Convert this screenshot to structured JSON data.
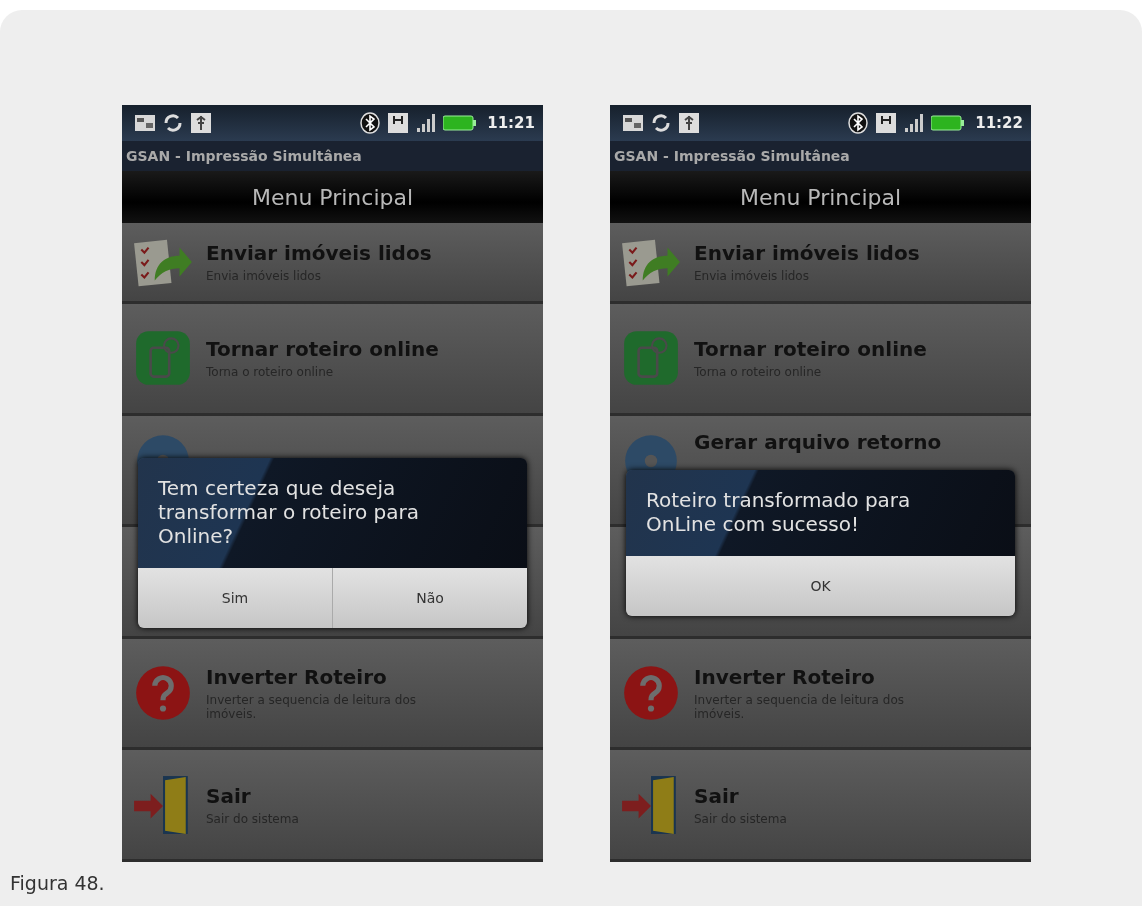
{
  "figures": [
    {
      "status_bar": {
        "time": "11:21"
      },
      "app_title": "GSAN - Impressão Simultânea",
      "header": "Menu Principal",
      "menu_items": [
        {
          "kind": "item",
          "title": "Enviar imóveis lidos",
          "subtitle": "Envia imóveis lidos"
        },
        {
          "kind": "item",
          "title": "Tornar roteiro online",
          "subtitle": "Torna o roteiro online"
        },
        {
          "kind": "covered"
        },
        {
          "kind": "covered"
        },
        {
          "kind": "item",
          "title": "Inverter Roteiro",
          "subtitle": "Inverter a sequencia de leitura dos imóveis."
        },
        {
          "kind": "item",
          "title": "Sair",
          "subtitle": "Sair do sistema"
        }
      ],
      "dialog": {
        "message": "Tem certeza que deseja transformar o roteiro para Online?",
        "buttons": [
          "Sim",
          "Não"
        ]
      }
    },
    {
      "status_bar": {
        "time": "11:22"
      },
      "app_title": "GSAN - Impressão Simultânea",
      "header": "Menu Principal",
      "menu_items": [
        {
          "kind": "item",
          "title": "Enviar imóveis lidos",
          "subtitle": "Envia imóveis lidos"
        },
        {
          "kind": "item",
          "title": "Tornar roteiro online",
          "subtitle": "Torna o roteiro online"
        },
        {
          "kind": "item",
          "title": "Gerar arquivo retorno"
        },
        {
          "kind": "covered"
        },
        {
          "kind": "item",
          "title": "Inverter Roteiro",
          "subtitle": "Inverter a sequencia de leitura dos imóveis."
        },
        {
          "kind": "item",
          "title": "Sair",
          "subtitle": "Sair do sistema"
        }
      ],
      "dialog": {
        "message": "Roteiro transformado para OnLine com sucesso!",
        "buttons": [
          "OK"
        ]
      }
    }
  ],
  "caption": "Figura 48."
}
